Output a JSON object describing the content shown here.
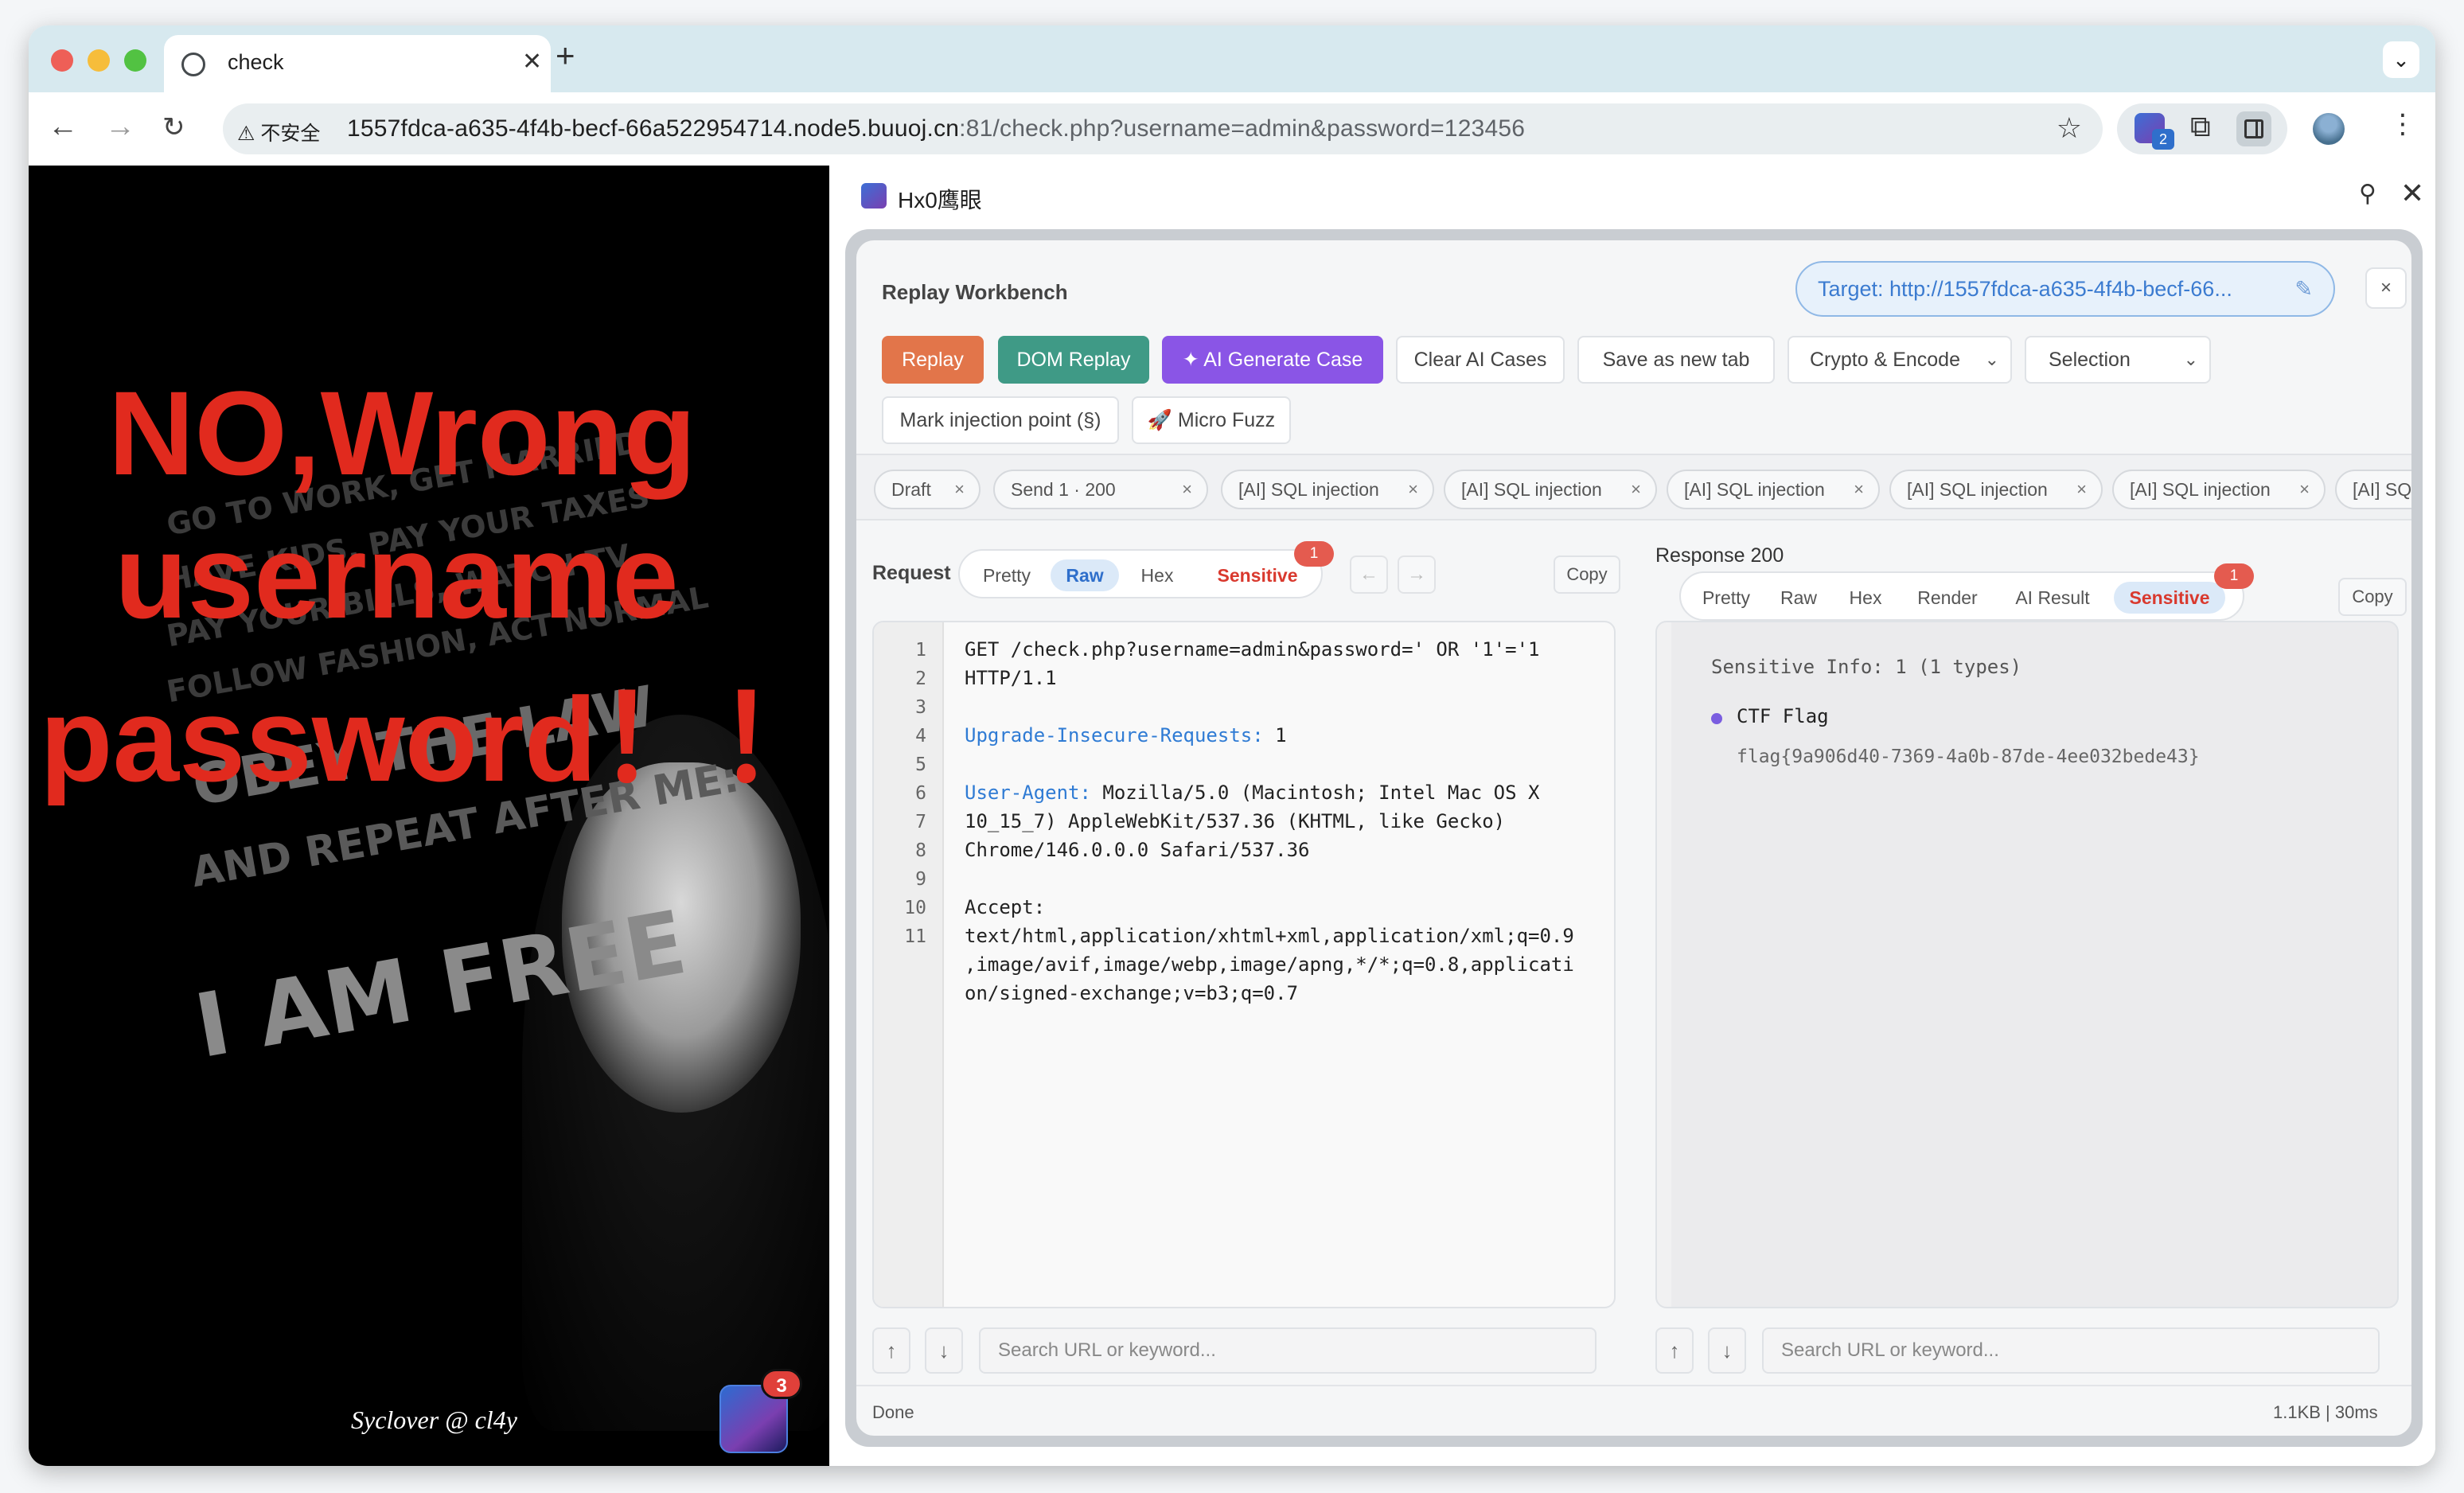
{
  "browser": {
    "tab_title": "check",
    "new_tab_label": "+",
    "insecure_label": "不安全",
    "url_host": "1557fdca-a635-4f4b-becf-66a522954714.node5.buuoj.cn",
    "url_rest": ":81/check.php?username=admin&password=123456",
    "extension_badge": "2",
    "icons": [
      "back-icon",
      "forward-icon",
      "reload-icon",
      "star-icon",
      "extension-icon",
      "puzzle-icon",
      "sidepanel-icon",
      "kebab-icon",
      "chevron-down-icon"
    ]
  },
  "page": {
    "error_line1": "NO,Wrong",
    "error_line2": "username",
    "error_line3": "password！！",
    "poster_lines": [
      "GO TO WORK, GET MARRIED",
      "HAVE KIDS, PAY YOUR TAXES",
      "PAY YOUR BILLS, WATCH TV",
      "FOLLOW FASHION, ACT NORMAL",
      "OBEY THE LAW",
      "AND REPEAT AFTER ME:",
      "I AM FREE"
    ],
    "signature": "Syclover @ cl4y",
    "ext_badge_count": "3"
  },
  "sidepanel": {
    "title": "Hx0鹰眼",
    "workbench_title": "Replay Workbench",
    "target": "Target: http://1557fdca-a635-4f4b-becf-66...",
    "close_label": "×",
    "buttons": {
      "replay": "Replay",
      "dom_replay": "DOM Replay",
      "ai_generate": "✦ AI Generate Case",
      "clear_ai": "Clear AI Cases",
      "save_tab": "Save as new tab",
      "crypto": "Crypto & Encode",
      "selection": "Selection",
      "mark_injection": "Mark injection point (§)",
      "micro_fuzz": "🚀 Micro Fuzz"
    },
    "chips": [
      "Draft",
      "Send 1 · 200",
      "[AI] SQL injection",
      "[AI] SQL injection",
      "[AI] SQL injection",
      "[AI] SQL injection",
      "[AI] SQL injection",
      "[AI] SQL inje"
    ],
    "request": {
      "label": "Request",
      "tabs": [
        "Pretty",
        "Raw",
        "Hex",
        "Sensitive"
      ],
      "active_tab": "Raw",
      "sensitive_count": "1",
      "prev": "←",
      "next": "→",
      "copy": "Copy",
      "line_numbers": [
        "1",
        "2",
        "3",
        "4",
        "5",
        "6",
        "7",
        "8",
        "9",
        "10",
        "11"
      ],
      "lines": {
        "l1a": "GET /check.php?username=admin&password=' OR '1'='1",
        "l1b": "HTTP/1.1",
        "l4k": "Upgrade-Insecure-Requests:",
        "l4v": " 1",
        "l6k": "User-Agent:",
        "l6v": " Mozilla/5.0 (Macintosh; Intel Mac OS X",
        "l6b": "10_15_7) AppleWebKit/537.36 (KHTML, like Gecko)",
        "l6c": "Chrome/146.0.0.0 Safari/537.36",
        "l10k": "Accept:",
        "l11a": "text/html,application/xhtml+xml,application/xml;q=0.9",
        "l11b": ",image/avif,image/webp,image/apng,*/*;q=0.8,applicati",
        "l11c": "on/signed-exchange;v=b3;q=0.7"
      },
      "search_placeholder": "Search URL or keyword...",
      "up": "↑",
      "down": "↓",
      "status": "Done"
    },
    "response": {
      "label": "Response 200",
      "tabs": [
        "Pretty",
        "Raw",
        "Hex",
        "Render",
        "AI Result",
        "Sensitive"
      ],
      "active_tab": "Sensitive",
      "sensitive_count": "1",
      "copy": "Copy",
      "sensitive_info": "Sensitive Info: 1 (1 types)",
      "item_title": "CTF Flag",
      "item_value": "flag{9a906d40-7369-4a0b-87de-4ee032bede43}",
      "search_placeholder": "Search URL or keyword...",
      "up": "↑",
      "down": "↓",
      "stats": "1.1KB | 30ms"
    },
    "colors": {
      "replay": "#e2754a",
      "dom_replay": "#3f9a86",
      "ai_generate": "#8a55e6",
      "accent_blue": "#2f6fcb",
      "sensitive_red": "#d9392e"
    }
  }
}
